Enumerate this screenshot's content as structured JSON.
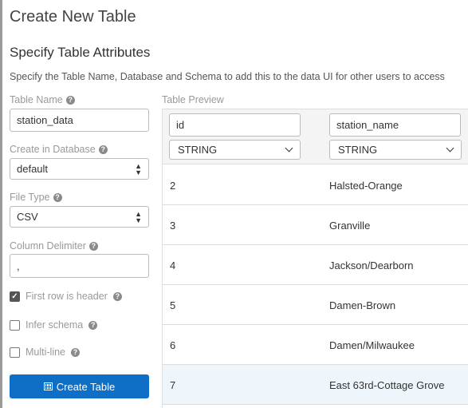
{
  "page_title": "Create New Table",
  "section": {
    "title": "Specify Table Attributes",
    "description": "Specify the Table Name, Database and Schema to add this to the data UI for other users to access"
  },
  "form": {
    "table_name": {
      "label": "Table Name",
      "value": "station_data"
    },
    "database": {
      "label": "Create in Database",
      "value": "default"
    },
    "file_type": {
      "label": "File Type",
      "value": "CSV"
    },
    "delimiter": {
      "label": "Column Delimiter",
      "value": ","
    },
    "first_row_header": {
      "label": "First row is header",
      "checked": true
    },
    "infer_schema": {
      "label": "Infer schema",
      "checked": false
    },
    "multi_line": {
      "label": "Multi-line",
      "checked": false
    },
    "help_glyph": "?",
    "create_button": "Create Table"
  },
  "preview": {
    "label": "Table Preview",
    "columns": [
      {
        "name": "id",
        "type": "STRING"
      },
      {
        "name": "station_name",
        "type": "STRING"
      }
    ],
    "rows": [
      [
        "2",
        "Halsted-Orange"
      ],
      [
        "3",
        "Granville"
      ],
      [
        "4",
        "Jackson/Dearborn"
      ],
      [
        "5",
        "Damen-Brown"
      ],
      [
        "6",
        "Damen/Milwaukee"
      ],
      [
        "7",
        "East 63rd-Cottage Grove"
      ]
    ],
    "highlighted_row": 5
  },
  "colors": {
    "primary_button": "#0f6ec5",
    "highlight_row": "#eef6fb"
  }
}
